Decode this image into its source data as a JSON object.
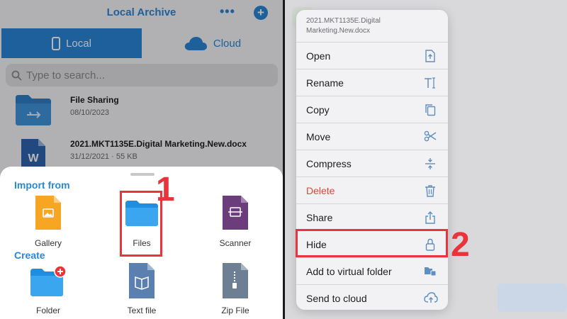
{
  "left": {
    "title": "Local Archive",
    "more": "•••",
    "add": "+",
    "tabs": {
      "local": "Local",
      "cloud": "Cloud"
    },
    "search_placeholder": "Type to search...",
    "files": [
      {
        "name": "File Sharing",
        "meta": "08/10/2023",
        "icon": "usb-folder-icon"
      },
      {
        "name": "2021.MKT1135E.Digital Marketing.New.docx",
        "meta": "31/12/2021 · 55 KB",
        "icon": "word-doc-icon"
      }
    ],
    "sheet": {
      "import_title": "Import from",
      "import_items": [
        {
          "label": "Gallery",
          "icon": "gallery-icon"
        },
        {
          "label": "Files",
          "icon": "files-folder-icon"
        },
        {
          "label": "Scanner",
          "icon": "scanner-icon"
        }
      ],
      "create_title": "Create",
      "create_items": [
        {
          "label": "Folder",
          "icon": "new-folder-icon"
        },
        {
          "label": "Text file",
          "icon": "text-file-icon"
        },
        {
          "label": "Zip File",
          "icon": "zip-file-icon"
        }
      ]
    },
    "step": "1"
  },
  "right": {
    "menu_header": "2021.MKT1135E.Digital Marketing.New.docx",
    "items": [
      {
        "label": "Open",
        "icon": "open-icon",
        "glyph": "⍐"
      },
      {
        "label": "Rename",
        "icon": "rename-icon",
        "glyph": "T"
      },
      {
        "label": "Copy",
        "icon": "copy-icon",
        "glyph": "⎘"
      },
      {
        "label": "Move",
        "icon": "scissors-icon",
        "glyph": "✂"
      },
      {
        "label": "Compress",
        "icon": "compress-icon",
        "glyph": "⇕"
      },
      {
        "label": "Delete",
        "icon": "trash-icon",
        "glyph": "🗑"
      },
      {
        "label": "Share",
        "icon": "share-icon",
        "glyph": "⇪"
      },
      {
        "label": "Hide",
        "icon": "lock-icon",
        "glyph": "🔒"
      },
      {
        "label": "Add to virtual folder",
        "icon": "virtual-folder-icon",
        "glyph": "▦"
      },
      {
        "label": "Send to cloud",
        "icon": "cloud-upload-icon",
        "glyph": "☁"
      }
    ],
    "step": "2"
  },
  "colors": {
    "accent": "#2a86d9",
    "highlight": "#e8343a",
    "delete": "#e0453a"
  }
}
